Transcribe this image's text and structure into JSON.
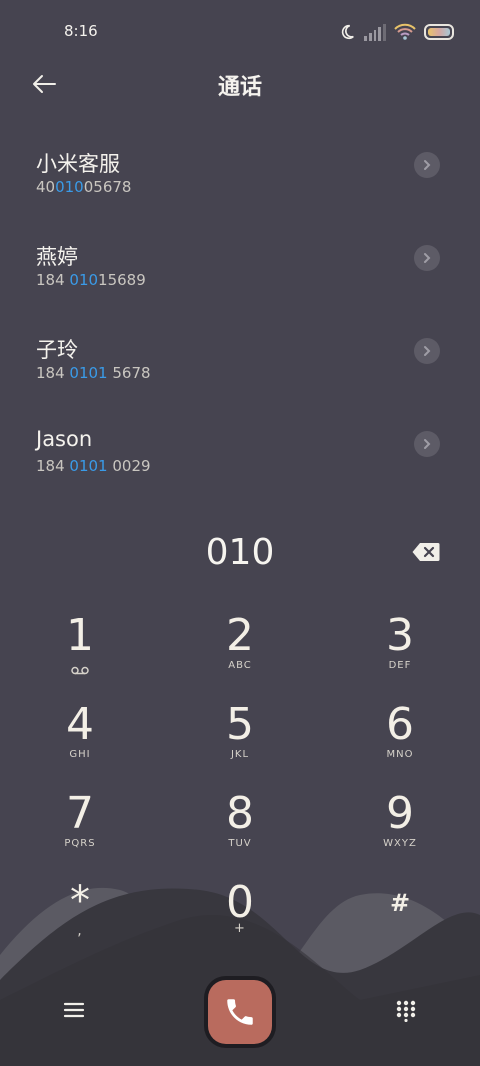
{
  "status_bar": {
    "time": "8:16",
    "icons": [
      "moon-icon",
      "signal-icon",
      "wifi-icon",
      "battery-icon"
    ]
  },
  "header": {
    "title": "通话",
    "back_icon": "back-arrow-icon"
  },
  "contacts": [
    {
      "name": "小米客服",
      "number_pre": "40",
      "number_match": "010",
      "number_post": "05678"
    },
    {
      "name": "燕婷",
      "number_pre": "184 ",
      "number_match": "010",
      "number_post": "15689"
    },
    {
      "name": "子玲",
      "number_pre": "184 ",
      "number_match": "0101",
      "number_post": " 5678"
    },
    {
      "name": "Jason",
      "number_pre": "184 ",
      "number_match": "0101",
      "number_post": " 0029"
    }
  ],
  "dial_entry": {
    "value": "010",
    "backspace_icon": "backspace-icon"
  },
  "keypad": {
    "keys": [
      {
        "digit": "1",
        "sub": "voicemail-icon"
      },
      {
        "digit": "2",
        "sub": "ABC"
      },
      {
        "digit": "3",
        "sub": "DEF"
      },
      {
        "digit": "4",
        "sub": "GHI"
      },
      {
        "digit": "5",
        "sub": "JKL"
      },
      {
        "digit": "6",
        "sub": "MNO"
      },
      {
        "digit": "7",
        "sub": "PQRS"
      },
      {
        "digit": "8",
        "sub": "TUV"
      },
      {
        "digit": "9",
        "sub": "WXYZ"
      },
      {
        "digit": "*",
        "sub": ","
      },
      {
        "digit": "0",
        "sub": "+"
      },
      {
        "digit": "#",
        "sub": ""
      }
    ]
  },
  "bottom_bar": {
    "menu_icon": "menu-icon",
    "call_icon": "phone-icon",
    "dialpad_icon": "dialpad-icon"
  },
  "colors": {
    "background": "#464450",
    "match_highlight": "#3a9be8",
    "call_button": "#b96b5e",
    "wave_light": "#5b5a63",
    "wave_dark": "#35343b"
  }
}
